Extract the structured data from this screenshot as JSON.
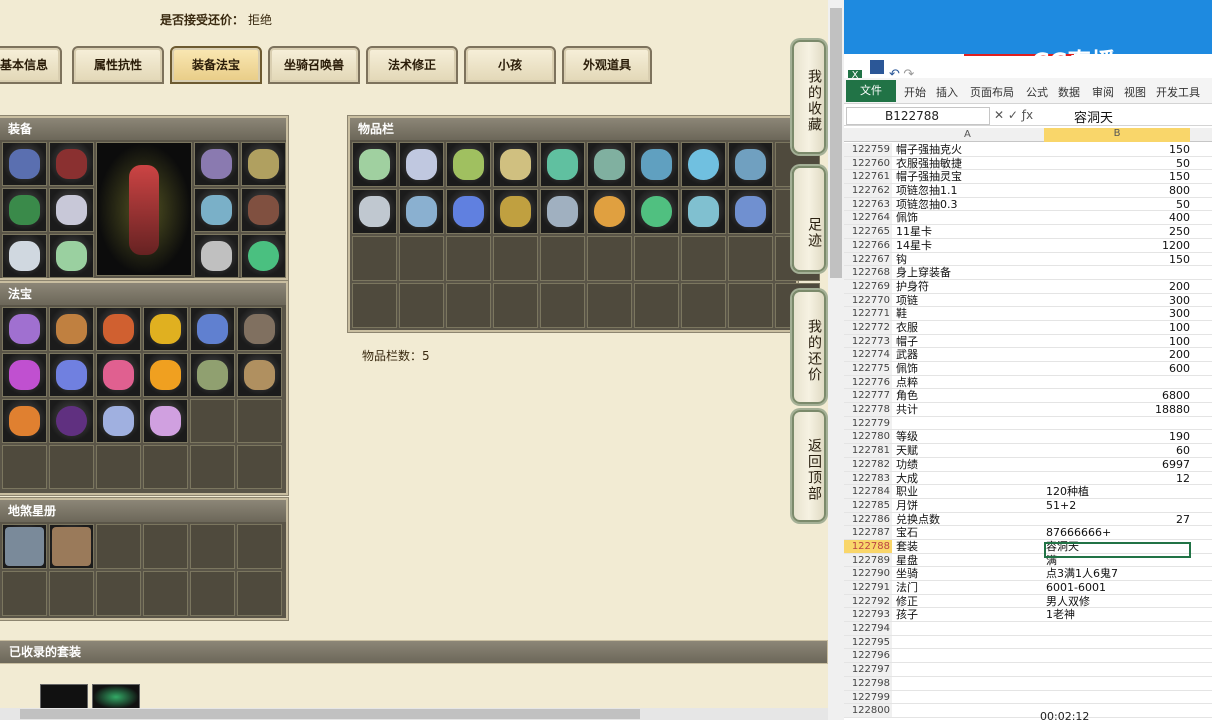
{
  "game": {
    "accept_label": "是否接受还价：",
    "accept_value": "拒绝",
    "tabs": [
      "基本信息",
      "属性抗性",
      "装备法宝",
      "坐骑召唤兽",
      "法术修正",
      "小孩",
      "外观道具"
    ],
    "panels": {
      "equip_title": "装备",
      "inventory_title": "物品栏",
      "fabao_title": "法宝",
      "book_title": "地煞星册",
      "suits_title": "已收录的套装",
      "inventory_count": "物品栏数：5"
    },
    "side_buttons": [
      "我的收藏",
      "足迹",
      "我的还价",
      "返回顶部"
    ]
  },
  "excel": {
    "ribbon_tabs": [
      "开始",
      "插入",
      "页面布局",
      "公式",
      "数据",
      "审阅",
      "视图",
      "开发工具"
    ],
    "file_label": "文件",
    "name_box": "B122788",
    "formula_value": "容洞天",
    "col_a": "A",
    "col_b": "B",
    "rows": [
      [
        "122759",
        "帽子强抽克火",
        "150"
      ],
      [
        "122760",
        "衣服强抽敏捷",
        "50"
      ],
      [
        "122761",
        "帽子强抽灵宝",
        "150"
      ],
      [
        "122762",
        "项链忽抽1.1",
        "800"
      ],
      [
        "122763",
        "项链忽抽0.3",
        "50"
      ],
      [
        "122764",
        "佩饰",
        "400"
      ],
      [
        "122765",
        "11星卡",
        "250"
      ],
      [
        "122766",
        "14星卡",
        "1200"
      ],
      [
        "122767",
        "钩",
        "150"
      ],
      [
        "122768",
        "身上穿装备",
        ""
      ],
      [
        "122769",
        "护身符",
        "200"
      ],
      [
        "122770",
        "项链",
        "300"
      ],
      [
        "122771",
        "鞋",
        "300"
      ],
      [
        "122772",
        "衣服",
        "100"
      ],
      [
        "122773",
        "帽子",
        "100"
      ],
      [
        "122774",
        "武器",
        "200"
      ],
      [
        "122775",
        "佩饰",
        "600"
      ],
      [
        "122776",
        "点粹",
        ""
      ],
      [
        "122777",
        "角色",
        "6800"
      ],
      [
        "122778",
        "共计",
        "18880"
      ],
      [
        "122779",
        "",
        ""
      ],
      [
        "122780",
        "等级",
        "190"
      ],
      [
        "122781",
        "天赋",
        "60"
      ],
      [
        "122782",
        "功绩",
        "6997"
      ],
      [
        "122783",
        "大成",
        "12"
      ],
      [
        "122784",
        "职业",
        "120种植"
      ],
      [
        "122785",
        "月饼",
        "51+2"
      ],
      [
        "122786",
        "兑换点数",
        "27"
      ],
      [
        "122787",
        "宝石",
        "87666666+"
      ],
      [
        "122788",
        "套装",
        "容洞天"
      ],
      [
        "122789",
        "星盘",
        "满"
      ],
      [
        "122790",
        "坐骑",
        "点3满1人6鬼7"
      ],
      [
        "122791",
        "法门",
        "6001-6001"
      ],
      [
        "122792",
        "修正",
        "男人双修"
      ],
      [
        "122793",
        "孩子",
        "1老神"
      ],
      [
        "122794",
        "",
        ""
      ],
      [
        "122795",
        "",
        ""
      ],
      [
        "122796",
        "",
        ""
      ],
      [
        "122797",
        "",
        ""
      ],
      [
        "122798",
        "",
        ""
      ],
      [
        "122799",
        "",
        ""
      ],
      [
        "122800",
        "",
        ""
      ]
    ],
    "timer": "00:02:12",
    "logo": "CC直播"
  },
  "colors": {
    "excel_green": "#217346",
    "titlebar_blue": "#1e8ae0",
    "panel": "#5a5548"
  }
}
